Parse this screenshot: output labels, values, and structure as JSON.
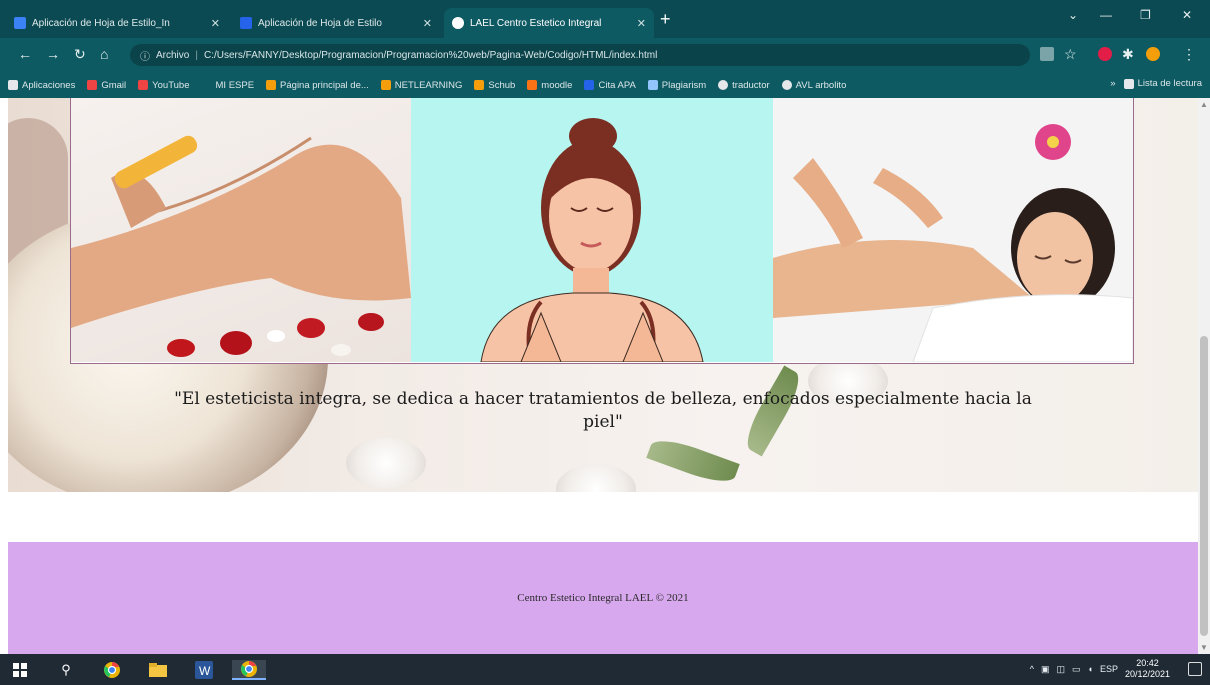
{
  "browser": {
    "tabs": [
      {
        "title": "Aplicación de Hoja de Estilo_In",
        "fav_color": "#3b82f6"
      },
      {
        "title": "Aplicación de Hoja de Estilo",
        "fav_color": "#2563eb"
      },
      {
        "title": "LAEL Centro Estetico Integral",
        "fav_color": "#ffffff",
        "active": true
      }
    ],
    "new_tab": "+",
    "window_controls": {
      "minimize": "—",
      "maximize": "❐",
      "close": "✕"
    },
    "address": {
      "scheme_label": "Archivo",
      "url": "C:/Users/FANNY/Desktop/Programacion/Programacion%20web/Pagina-Web/Codigo/HTML/index.html"
    },
    "bookmarks": [
      {
        "label": "Aplicaciones",
        "color": "#e5e7eb"
      },
      {
        "label": "Gmail",
        "color": "#ef4444"
      },
      {
        "label": "YouTube",
        "color": "#ef4444"
      },
      {
        "label": "MI ESPE",
        "color": "#0e5a63"
      },
      {
        "label": "Página principal de...",
        "color": "#f59e0b"
      },
      {
        "label": "NETLEARNING",
        "color": "#f59e0b"
      },
      {
        "label": "Schub",
        "color": "#f59e0b"
      },
      {
        "label": "moodle",
        "color": "#f97316"
      },
      {
        "label": "Cita APA",
        "color": "#2563eb"
      },
      {
        "label": "Plagiarism",
        "color": "#93c5fd"
      },
      {
        "label": "traductor",
        "color": "#e5e7eb"
      },
      {
        "label": "AVL arbolito",
        "color": "#e5e7eb"
      }
    ],
    "reading_list": "Lista de lectura"
  },
  "page": {
    "quote": "\"El esteticista integra, se dedica a hacer tratamientos de belleza, enfocados especialmente hacia la piel\"",
    "footer": "Centro Estetico Integral LAEL © 2021"
  },
  "taskbar": {
    "tray_lang": "ESP",
    "time": "20:42",
    "date": "20/12/2021"
  }
}
